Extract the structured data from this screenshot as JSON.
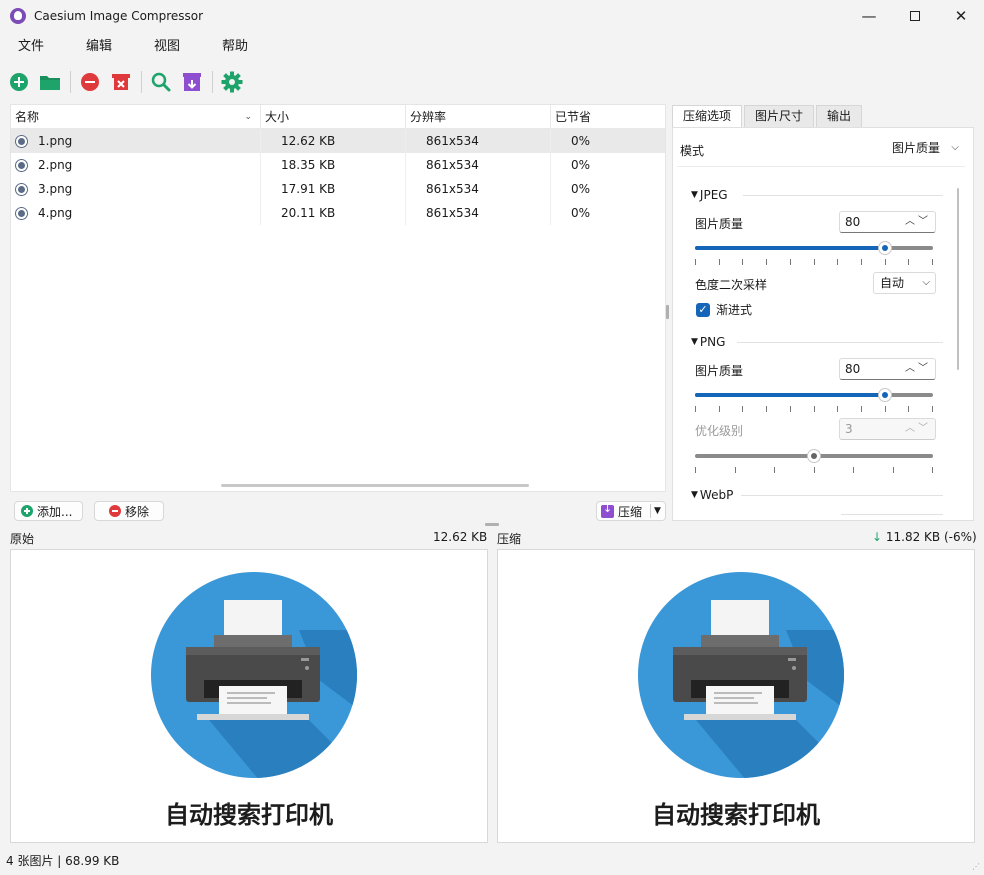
{
  "window": {
    "title": "Caesium Image Compressor",
    "min_glyph": "—",
    "close_glyph": "✕"
  },
  "menu": [
    "文件",
    "编辑",
    "视图",
    "帮助"
  ],
  "toolbar": [
    {
      "name": "add-icon",
      "color": "#1ea36b"
    },
    {
      "name": "folder-icon",
      "color": "#1ea36b"
    },
    {
      "name": "remove-icon",
      "color": "#e0393b"
    },
    {
      "name": "clear-list-icon",
      "color": "#e0393b"
    },
    {
      "name": "search-icon",
      "color": "#1ea36b"
    },
    {
      "name": "compress-download-icon",
      "color": "#8e4ed0"
    },
    {
      "name": "settings-gear-icon",
      "color": "#1ea36b"
    }
  ],
  "file_list": {
    "columns": [
      "名称",
      "大小",
      "分辨率",
      "已节省"
    ],
    "rows": [
      {
        "name": "1.png",
        "size": "12.62 KB",
        "resolution": "861x534",
        "saved": "0%",
        "selected": true
      },
      {
        "name": "2.png",
        "size": "18.35 KB",
        "resolution": "861x534",
        "saved": "0%",
        "selected": false
      },
      {
        "name": "3.png",
        "size": "17.91 KB",
        "resolution": "861x534",
        "saved": "0%",
        "selected": false
      },
      {
        "name": "4.png",
        "size": "20.11 KB",
        "resolution": "861x534",
        "saved": "0%",
        "selected": false
      }
    ]
  },
  "tabs": [
    "压缩选项",
    "图片尺寸",
    "输出"
  ],
  "options": {
    "mode_label": "模式",
    "mode_value": "图片质量",
    "jpeg": {
      "title": "JPEG",
      "quality_label": "图片质量",
      "quality_value": "80",
      "quality_level": 80,
      "chroma_label": "色度二次采样",
      "chroma_value": "自动",
      "progressive_label": "渐进式",
      "progressive_checked": true
    },
    "png": {
      "title": "PNG",
      "quality_label": "图片质量",
      "quality_value": "80",
      "quality_level": 80,
      "opt_label": "优化级别",
      "opt_value": "3",
      "opt_level": 3
    },
    "webp": {
      "title": "WebP"
    }
  },
  "buttons": {
    "add": "添加...",
    "remove": "移除",
    "compress": "压缩"
  },
  "preview": {
    "original_label": "原始",
    "original_size": "12.62 KB",
    "compressed_label": "压缩",
    "compressed_arrow": "↓",
    "compressed_size": "11.82 KB (-6%)",
    "caption": "自动搜索打印机"
  },
  "status": "4 张图片 | 68.99 KB"
}
